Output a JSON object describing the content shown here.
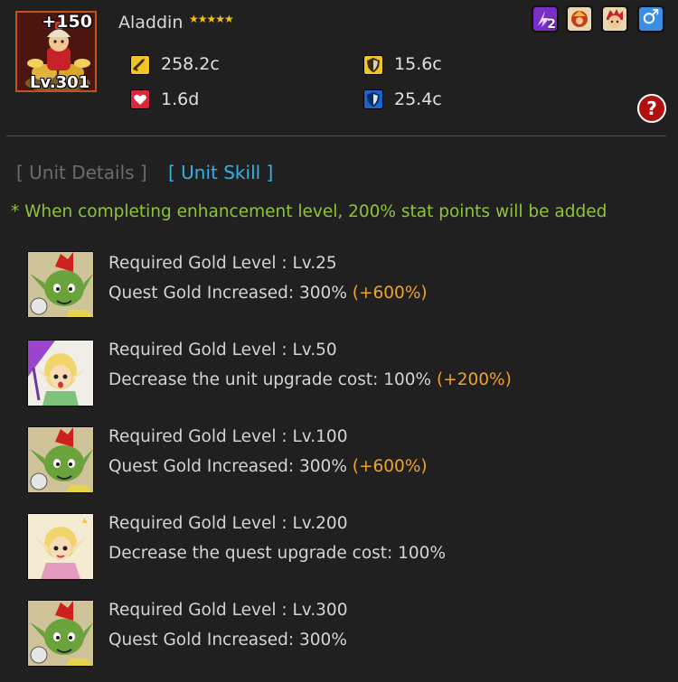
{
  "unit": {
    "plus": "+150",
    "level": "Lv.301",
    "name": "Aladdin",
    "stars": "★★★★★",
    "stats": {
      "attack": "258.2c",
      "defense": "15.6c",
      "health": "1.6d",
      "magic_defense": "25.4c"
    }
  },
  "top_icons": {
    "badge_count": "2",
    "gender_symbol": "♂"
  },
  "help_label": "?",
  "tabs": {
    "details": "[ Unit Details ]",
    "skill": "[ Unit Skill ]"
  },
  "note": "* When completing enhancement level, 200% stat points will be added",
  "skills": [
    {
      "requirement": "Required Gold Level : Lv.25",
      "effect": "Quest Gold Increased: 300%",
      "bonus": "(+600%)",
      "icon": "goblin-icon"
    },
    {
      "requirement": "Required Gold Level : Lv.50",
      "effect": "Decrease the unit upgrade cost: 100%",
      "bonus": "(+200%)",
      "icon": "elf-mage-icon"
    },
    {
      "requirement": "Required Gold Level : Lv.100",
      "effect": "Quest Gold Increased: 300%",
      "bonus": "(+600%)",
      "icon": "goblin-icon"
    },
    {
      "requirement": "Required Gold Level : Lv.200",
      "effect": "Decrease the quest upgrade cost: 100%",
      "bonus": "",
      "icon": "elf-girl-icon"
    },
    {
      "requirement": "Required Gold Level : Lv.300",
      "effect": "Quest Gold Increased: 300%",
      "bonus": "",
      "icon": "goblin-icon"
    }
  ],
  "colors": {
    "background": "#202020",
    "skill_tab": "#2fb3e8",
    "note": "#8fc43a",
    "bonus": "#f0a22a"
  }
}
